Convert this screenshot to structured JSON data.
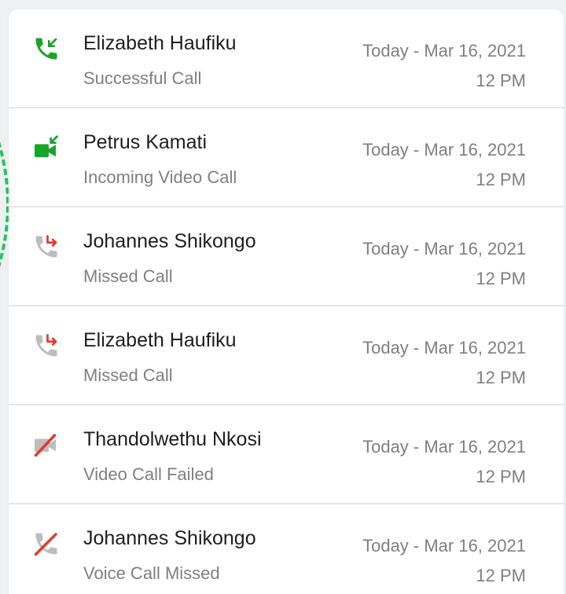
{
  "colors": {
    "accent_green": "#1aa32a",
    "missed_red": "#e23b2e",
    "muted_gray": "#bdbdbd",
    "name_text": "#1e1e1e",
    "secondary_text": "#7f7f7f"
  },
  "call_log": [
    {
      "name": "Elizabeth Haufiku",
      "status": "Successful Call",
      "date": "Today - Mar 16, 2021",
      "time": "12 PM",
      "icon": "incoming-call-icon"
    },
    {
      "name": "Petrus Kamati",
      "status": "Incoming Video Call",
      "date": "Today - Mar 16, 2021",
      "time": "12 PM",
      "icon": "incoming-video-call-icon"
    },
    {
      "name": "Johannes Shikongo",
      "status": "Missed Call",
      "date": "Today - Mar 16, 2021",
      "time": "12 PM",
      "icon": "missed-call-icon"
    },
    {
      "name": "Elizabeth Haufiku",
      "status": "Missed Call",
      "date": "Today - Mar 16, 2021",
      "time": "12 PM",
      "icon": "missed-call-icon"
    },
    {
      "name": "Thandolwethu Nkosi",
      "status": "Video Call Failed",
      "date": "Today - Mar 16, 2021",
      "time": "12 PM",
      "icon": "failed-video-call-icon"
    },
    {
      "name": "Johannes Shikongo",
      "status": "Voice Call Missed",
      "date": "Today - Mar 16, 2021",
      "time": "12 PM",
      "icon": "voice-call-missed-icon"
    }
  ]
}
